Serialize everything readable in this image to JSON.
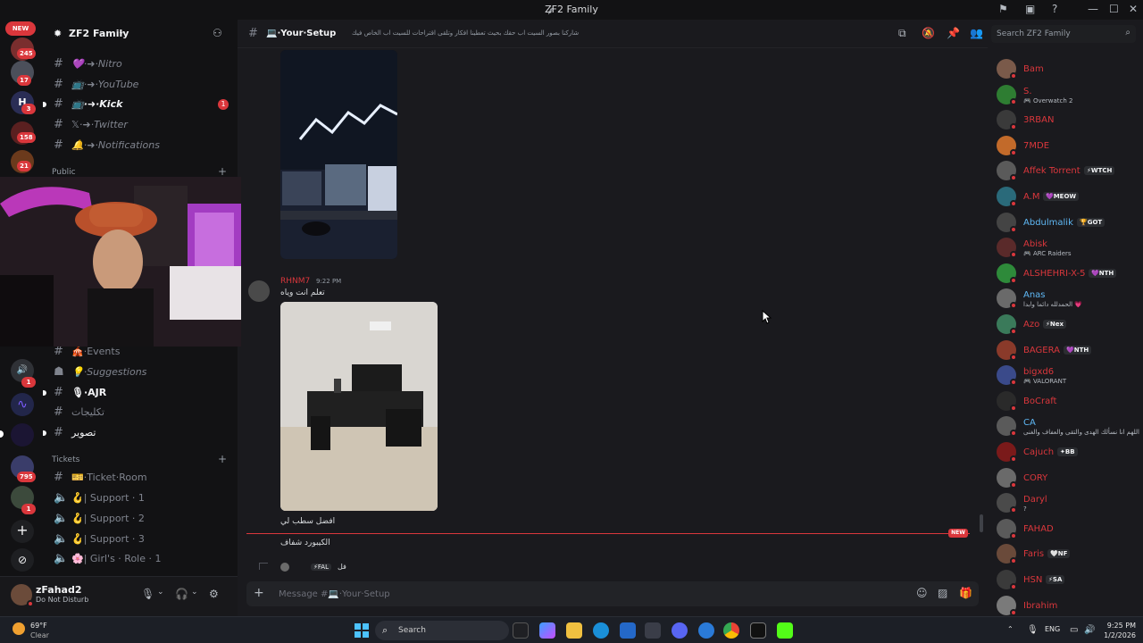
{
  "window": {
    "title": "ZF2 Family"
  },
  "server": {
    "name": "ZF2 Family"
  },
  "rail": {
    "badges": [
      "245",
      "17",
      "3",
      "158",
      "21",
      "1",
      "795",
      "1"
    ],
    "new_label": "NEW"
  },
  "channels": {
    "top": [
      {
        "label": "💜·➜·Nitro",
        "bold": false
      },
      {
        "label": "📺·➜·YouTube",
        "bold": false
      },
      {
        "label": "📺·➜·Kick",
        "bold": true,
        "mentions": "1"
      },
      {
        "label": "𝕏·➜·Twitter",
        "bold": false
      },
      {
        "label": "🔔·➜·Notifications",
        "bold": false
      }
    ],
    "category_public": "Public",
    "middle": [
      {
        "label": "🎪·Events",
        "bold": false
      },
      {
        "label": "💡·Suggestions",
        "bold": false
      },
      {
        "label": "🎙·AJR",
        "bold": true
      },
      {
        "label": "تكليجات",
        "bold": false
      },
      {
        "label": "تصوير",
        "bold": true
      }
    ],
    "category_tickets": "Tickets",
    "tickets": [
      {
        "label": "🎫·Ticket·Room"
      },
      {
        "label": "🪝| Support · 1"
      },
      {
        "label": "🪝| Support · 2"
      },
      {
        "label": "🪝| Support · 3"
      },
      {
        "label": "🌸| Girl's · Role · 1"
      }
    ]
  },
  "user": {
    "name": "zFahad2",
    "status": "Do Not Disturb"
  },
  "channel": {
    "name": "💻·Your·Setup",
    "topic": "شاركنا بصور السيت اب حقك بحيث تعطينا افكار وتلقى اقتراحات للسيت اب الخاص فيك"
  },
  "messages": {
    "author": "RHNM7",
    "time": "9:22 PM",
    "text1": "تعلم انت وياه",
    "text2": "افضل سطب لي",
    "text3": "الكيبورد شفاف",
    "new_label": "NEW",
    "reply_tag": "⚡FAL",
    "reply_text": "فل"
  },
  "composer": {
    "placeholder": "Message #💻·Your·Setup"
  },
  "members": {
    "search_placeholder": "Search ZF2 Family",
    "list": [
      {
        "name": "Bam",
        "sub": "",
        "tag": "",
        "color": "#da373c"
      },
      {
        "name": "S.",
        "sub": "🎮 Overwatch 2",
        "tag": "",
        "color": "#da373c"
      },
      {
        "name": "3RBAN",
        "sub": "",
        "tag": "",
        "color": "#da373c"
      },
      {
        "name": "7MDE",
        "sub": "",
        "tag": "",
        "color": "#da373c"
      },
      {
        "name": "Affek Torrent",
        "sub": "",
        "tag": "⚡WTCH",
        "color": "#da373c"
      },
      {
        "name": "A.M",
        "sub": "",
        "tag": "💜MEOW",
        "color": "#da373c"
      },
      {
        "name": "Abdulmalik",
        "sub": "",
        "tag": "🏆GOT",
        "color": "#5fb8f5"
      },
      {
        "name": "Abisk",
        "sub": "🎮 ARC Raiders",
        "tag": "",
        "color": "#da373c"
      },
      {
        "name": "ALSHEHRI-X-5",
        "sub": "",
        "tag": "💜NTH",
        "color": "#da373c"
      },
      {
        "name": "Anas",
        "sub": "الحمدلله دائما وابدا 💗",
        "tag": "",
        "color": "#5fb8f5"
      },
      {
        "name": "Azo",
        "sub": "",
        "tag": "⚡Nex",
        "color": "#da373c"
      },
      {
        "name": "BAGERA",
        "sub": "",
        "tag": "💜NTH",
        "color": "#da373c"
      },
      {
        "name": "bigxd6",
        "sub": "🎮 VALORANT",
        "tag": "",
        "color": "#da373c"
      },
      {
        "name": "BoCraft",
        "sub": "",
        "tag": "",
        "color": "#da373c"
      },
      {
        "name": "CA",
        "sub": "اللهم انا نسألك الهدى والتقى والعفاف والغنى",
        "tag": "",
        "color": "#5fb8f5"
      },
      {
        "name": "Cajuch",
        "sub": "",
        "tag": "✦BB",
        "color": "#da373c"
      },
      {
        "name": "CORY",
        "sub": "",
        "tag": "",
        "color": "#da373c"
      },
      {
        "name": "Daryl",
        "sub": "?",
        "tag": "",
        "color": "#da373c"
      },
      {
        "name": "FAHAD",
        "sub": "",
        "tag": "",
        "color": "#da373c"
      },
      {
        "name": "Faris",
        "sub": "",
        "tag": "🤍NF",
        "color": "#da373c"
      },
      {
        "name": "HSN",
        "sub": "",
        "tag": "⚡SA",
        "color": "#da373c"
      },
      {
        "name": "Ibrahim",
        "sub": "",
        "tag": "",
        "color": "#da373c"
      }
    ]
  },
  "taskbar": {
    "temperature": "69°F",
    "condition": "Clear",
    "search": "Search",
    "lang": "ENG",
    "time": "9:25 PM",
    "date": "1/2/2026"
  },
  "colors": {
    "accent_red": "#da373c",
    "link_blue": "#5fb8f5",
    "background": "#1a1a1e"
  }
}
